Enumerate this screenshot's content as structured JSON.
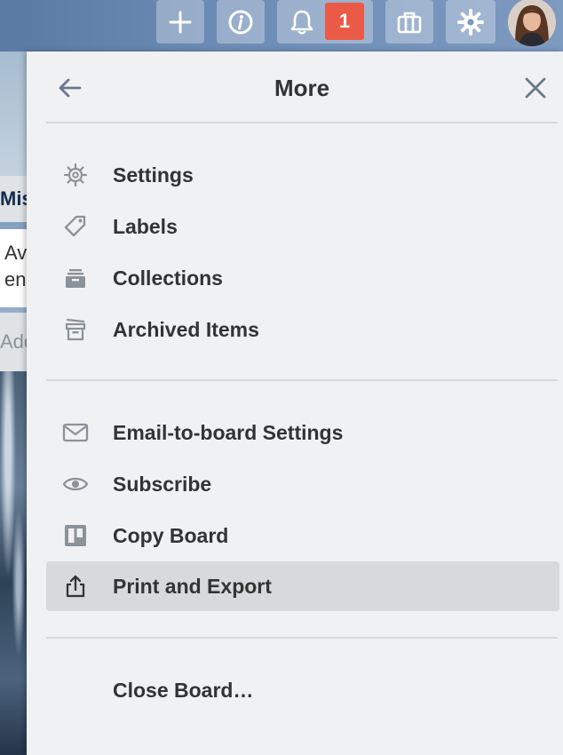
{
  "header": {
    "notification_count": "1"
  },
  "board": {
    "list_title": "Mis",
    "card_text_line1": "Av",
    "card_text_line2": "en",
    "add_card": "Add"
  },
  "panel": {
    "title": "More",
    "sections": [
      {
        "items": [
          {
            "label": "Settings",
            "icon": "gear-icon"
          },
          {
            "label": "Labels",
            "icon": "tag-icon"
          },
          {
            "label": "Collections",
            "icon": "collection-icon"
          },
          {
            "label": "Archived Items",
            "icon": "archive-icon"
          }
        ]
      },
      {
        "items": [
          {
            "label": "Email-to-board Settings",
            "icon": "envelope-icon"
          },
          {
            "label": "Subscribe",
            "icon": "eye-icon"
          },
          {
            "label": "Copy Board",
            "icon": "board-icon"
          },
          {
            "label": "Print and Export",
            "icon": "share-icon"
          }
        ]
      },
      {
        "items": [
          {
            "label": "Close Board…",
            "icon": ""
          }
        ]
      }
    ]
  },
  "colors": {
    "panel_bg": "#f0f1f3",
    "hover_bg": "#d6dadc",
    "badge_red": "#eb5a46",
    "text": "#333333",
    "icon_gray": "#6b778c"
  }
}
